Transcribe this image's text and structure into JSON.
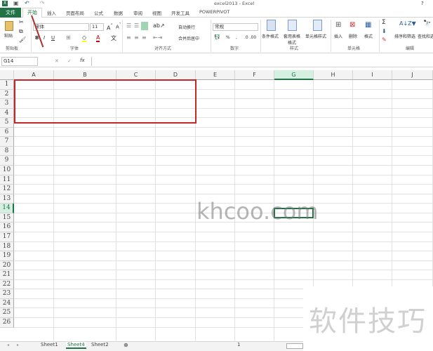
{
  "title": "excel2013 - Excel",
  "help": "?",
  "quick_access": {
    "save": "save-icon",
    "undo": "undo-icon",
    "redo": "redo-icon"
  },
  "tabs": [
    "文件",
    "开始",
    "插入",
    "页面布局",
    "公式",
    "数据",
    "审阅",
    "视图",
    "开发工具",
    "POWERPIVOT"
  ],
  "ribbon": {
    "paste": "粘贴",
    "clipboard": "剪贴板",
    "font_name": "宋体",
    "font_size": "11",
    "font_group": "字体",
    "bold": "B",
    "italic": "I",
    "underline": "U",
    "wrap": "自动换行",
    "merge": "合并后居中",
    "align_group": "对齐方式",
    "number_format": "常规",
    "percent": "%",
    "comma": ",",
    "number_group": "数字",
    "cond_format": "条件格式",
    "table_format": "套用表格格式",
    "cell_style": "单元格样式",
    "styles_group": "样式",
    "insert": "插入",
    "delete": "删除",
    "format": "格式",
    "cells_group": "单元格",
    "sum": "Σ",
    "sort": "排序和筛选",
    "find": "查找和选择",
    "edit_group": "编辑"
  },
  "formula_bar": {
    "name_box": "G14",
    "fx": "fx",
    "cancel": "✕",
    "confirm": "✓",
    "value": ""
  },
  "columns": [
    "A",
    "B",
    "C",
    "D",
    "E",
    "F",
    "G",
    "H",
    "I",
    "J"
  ],
  "rows": [
    "1",
    "2",
    "3",
    "4",
    "5",
    "6",
    "7",
    "8",
    "9",
    "10",
    "11",
    "12",
    "13",
    "14",
    "15",
    "16",
    "17",
    "18",
    "19",
    "20",
    "21",
    "22",
    "23",
    "24",
    "25",
    "26"
  ],
  "selected_cell": "G14",
  "sheets": [
    "Sheet1",
    "Sheet4",
    "Sheet2"
  ],
  "active_sheet": "Sheet4",
  "page_indicator": "1",
  "watermarks": [
    "khcoo.com",
    "软件技巧"
  ],
  "colors": {
    "accent": "#217346",
    "highlight": "#c0282a"
  }
}
